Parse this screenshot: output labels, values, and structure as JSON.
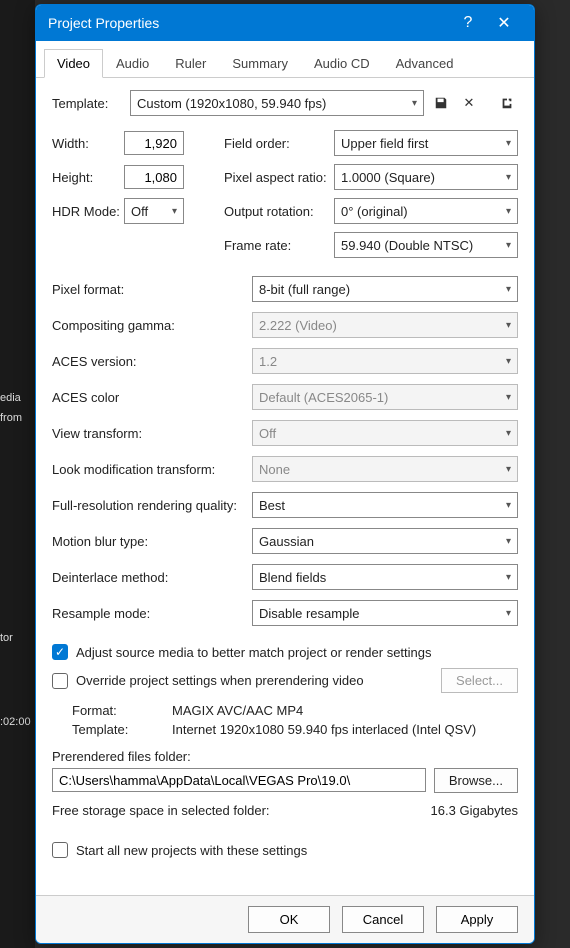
{
  "bg": {
    "media": "edia",
    "from": "from",
    "tor": "tor",
    "time": ":02:00"
  },
  "titlebar": {
    "title": "Project Properties",
    "help": "?",
    "close": "✕"
  },
  "tabs": [
    "Video",
    "Audio",
    "Ruler",
    "Summary",
    "Audio CD",
    "Advanced"
  ],
  "template": {
    "label": "Template:",
    "value": "Custom (1920x1080, 59.940 fps)",
    "save_icon": "💾",
    "delete_icon": "✕",
    "match_icon": "↘"
  },
  "top": {
    "width_label": "Width:",
    "width": "1,920",
    "height_label": "Height:",
    "height": "1,080",
    "hdr_label": "HDR Mode:",
    "hdr": "Off",
    "field_label": "Field order:",
    "field": "Upper field first",
    "par_label": "Pixel aspect ratio:",
    "par": "1.0000 (Square)",
    "rot_label": "Output rotation:",
    "rot": "0° (original)",
    "fps_label": "Frame rate:",
    "fps": "59.940 (Double NTSC)"
  },
  "mid": {
    "pixfmt_label": "Pixel format:",
    "pixfmt": "8-bit (full range)",
    "gamma_label": "Compositing gamma:",
    "gamma": "2.222 (Video)",
    "aces_label": "ACES version:",
    "aces": "1.2",
    "acescolor_label": "ACES color",
    "acescolor": "Default (ACES2065-1)",
    "view_label": "View transform:",
    "view": "Off",
    "look_label": "Look modification transform:",
    "look": "None",
    "quality_label": "Full-resolution rendering quality:",
    "quality": "Best",
    "blur_label": "Motion blur type:",
    "blur": "Gaussian",
    "deint_label": "Deinterlace method:",
    "deint": "Blend fields",
    "resample_label": "Resample mode:",
    "resample": "Disable resample"
  },
  "checks": {
    "adjust": "Adjust source media to better match project or render settings",
    "override": "Override project settings when prerendering video",
    "select_btn": "Select...",
    "format_label": "Format:",
    "format": "MAGIX AVC/AAC MP4",
    "template_label": "Template:",
    "template": "Internet 1920x1080 59.940 fps interlaced (Intel QSV)",
    "folder_label": "Prerendered files folder:",
    "folder": "C:\\Users\\hamma\\AppData\\Local\\VEGAS Pro\\19.0\\",
    "browse": "Browse...",
    "storage_label": "Free storage space in selected folder:",
    "storage": "16.3 Gigabytes",
    "start_all": "Start all new projects with these settings"
  },
  "footer": {
    "ok": "OK",
    "cancel": "Cancel",
    "apply": "Apply"
  }
}
